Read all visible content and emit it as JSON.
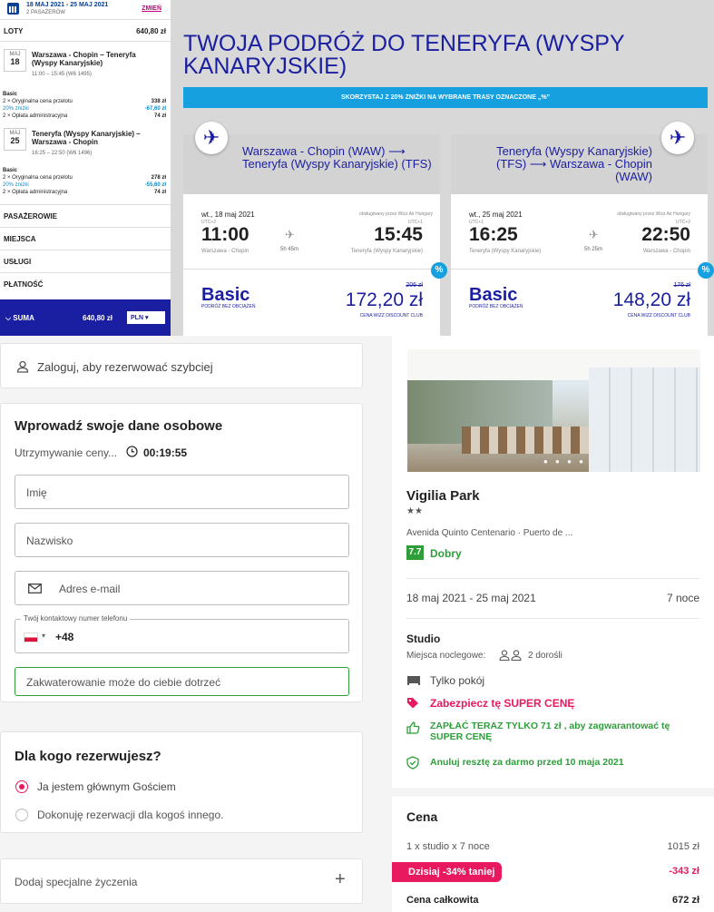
{
  "sidebar": {
    "dates": "18 MAJ 2021 - 25 MAJ 2021",
    "passengers": "2 PASAŻERÓW",
    "change_link": "ZMIEŃ",
    "flights_label": "LOTY",
    "flights_total": "640,80 zł",
    "outbound": {
      "month": "MAJ",
      "day": "18",
      "title": "Warszawa - Chopin – Teneryfa (Wyspy Kanaryjskie)",
      "time": "11:00 – 15:45 (W6 1495)",
      "fare_name": "Basic",
      "lines": [
        {
          "label": "2 × Oryginalna cena przelotu",
          "value": "338 zł",
          "highlight": false
        },
        {
          "label": "20% zniżki",
          "value": "-67,60 zł",
          "highlight": true
        },
        {
          "label": "2 × Opłata administracyjna",
          "value": "74 zł",
          "highlight": false
        }
      ]
    },
    "inbound": {
      "month": "MAJ",
      "day": "25",
      "title": "Teneryfa (Wyspy Kanaryjskie) – Warszawa - Chopin",
      "time": "16:25 – 22:50 (W6 1496)",
      "fare_name": "Basic",
      "lines": [
        {
          "label": "2 × Oryginalna cena przelotu",
          "value": "278 zł",
          "highlight": false
        },
        {
          "label": "20% zniżki",
          "value": "-55,60 zł",
          "highlight": true
        },
        {
          "label": "2 × Opłata administracyjna",
          "value": "74 zł",
          "highlight": false
        }
      ]
    },
    "sections": [
      "PASAŻEROWIE",
      "MIEJSCA",
      "USŁUGI",
      "PŁATNOŚĆ"
    ],
    "sum_label": "SUMA",
    "sum_value": "640,80 zł",
    "currency": "PLN"
  },
  "trip": {
    "title": "TWOJA PODRÓŻ DO TENERYFA (WYSPY KANARYJSKIE)",
    "banner": "SKORZYSTAJ Z 20% ZNIŻKI NA WYBRANE TRASY OZNACZONE „%”",
    "cards": [
      {
        "route": "Warszawa - Chopin (WAW) ⟶ Teneryfa (Wyspy Kanaryjskie) (TFS)",
        "date": "wt., 18 maj 2021",
        "operator": "obsługiwany przez Wizz Air Hungary",
        "dep_utc": "UTC+2",
        "arr_utc": "UTC+1",
        "dep_time": "11:00",
        "arr_time": "15:45",
        "duration": "5h 45m",
        "dep_city": "Warszawa - Chopin",
        "arr_city": "Teneryfa (Wyspy Kanaryjskie)",
        "fare": "Basic",
        "fare_sub": "PODRÓŻ BEZ OBCIĄŻEŃ",
        "old_price": "206 zł",
        "price": "172,20 zł",
        "club": "CENA WIZZ DISCOUNT CLUB"
      },
      {
        "route": "Teneryfa (Wyspy Kanaryjskie) (TFS) ⟶ Warszawa - Chopin (WAW)",
        "date": "wt., 25 maj 2021",
        "operator": "obsługiwany przez Wizz Air Hungary",
        "dep_utc": "UTC+1",
        "arr_utc": "UTC+2",
        "dep_time": "16:25",
        "arr_time": "22:50",
        "duration": "5h 25m",
        "dep_city": "Teneryfa (Wyspy Kanaryjskie)",
        "arr_city": "Warszawa - Chopin",
        "fare": "Basic",
        "fare_sub": "PODRÓŻ BEZ OBCIĄŻEŃ",
        "old_price": "176 zł",
        "price": "148,20 zł",
        "club": "CENA WIZZ DISCOUNT CLUB"
      }
    ],
    "discount_badge": "%"
  },
  "form": {
    "login": "Zaloguj, aby rezerwować szybciej",
    "personal_title": "Wprowadź swoje dane osobowe",
    "hold_label": "Utrzymywanie ceny...",
    "hold_timer": "00:19:55",
    "first_name_placeholder": "Imię",
    "last_name_placeholder": "Nazwisko",
    "email_placeholder": "Adres e-mail",
    "phone_legend": "Twój kontaktowy numer telefonu",
    "phone_prefix": "+48",
    "contact_note": "Zakwaterowanie może do ciebie dotrzeć",
    "for_whom_title": "Dla kogo rezerwujesz?",
    "option_main_guest": "Ja jestem głównym Gościem",
    "option_other": "Dokonuję rezerwacji dla kogoś innego.",
    "special_requests": "Dodaj specjalne życzenia",
    "plus": "+"
  },
  "hotel": {
    "name": "Vigilia Park",
    "stars": "★★",
    "address": "Avenida Quinto Centenario · Puerto de ...",
    "score": "7.7",
    "score_label": "Dobry",
    "dates": "18 maj 2021 - 25 maj 2021",
    "nights": "7 noce",
    "room_type": "Studio",
    "sleeps_label": "Miejsca noclegowe:",
    "sleeps_value": "2 dorośli",
    "room_only": "Tylko pokój",
    "secure_price": "Zabezpiecz tę SUPER CENĘ",
    "pay_now": "ZAPŁAĆ TERAZ TYLKO 71 zł , aby zagwarantować tę SUPER CENĘ",
    "cancel_free": "Anuluj resztę za darmo przed 10 maja 2021",
    "price_title": "Cena",
    "line_label": "1 x studio  x 7 noce",
    "line_value": "1015 zł",
    "today_label": "Dzisiaj -34% taniej",
    "today_value": "-343 zł",
    "total_label": "Cena całkowita",
    "total_value": "672 zł"
  },
  "colors": {
    "wizz_blue": "#1a1ea0",
    "wizz_cyan": "#17a0e0",
    "wizz_pink": "#c6007e",
    "accent_pink": "#e8195e",
    "green": "#2e9e3a"
  }
}
